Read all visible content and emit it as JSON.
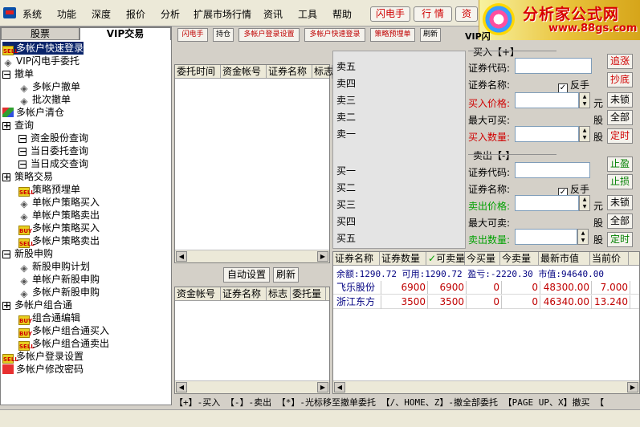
{
  "menu": [
    "系统",
    "功能",
    "深度",
    "报价",
    "分析",
    "扩展市场行情",
    "资讯",
    "工具",
    "帮助"
  ],
  "top_buttons": [
    "闪电手",
    "行 情",
    "资"
  ],
  "brand": {
    "title": "分析家公式网",
    "url": "www.88gs.com"
  },
  "left_tabs": [
    "股票",
    "VIP交易"
  ],
  "tree": [
    {
      "label": "多帐户快速登录",
      "icon": "sell",
      "indent": 0,
      "selected": true
    },
    {
      "label": "VIP闪电手委托",
      "icon": "diamond",
      "indent": 0
    },
    {
      "label": "撤单",
      "icon": "box",
      "indent": 0,
      "box": "−"
    },
    {
      "label": "多帐户撤单",
      "icon": "diamond",
      "indent": 1
    },
    {
      "label": "批次撤单",
      "icon": "diamond",
      "indent": 1
    },
    {
      "label": "多帐户清仓",
      "icon": "multi",
      "indent": 0
    },
    {
      "label": "查询",
      "icon": "box",
      "indent": 0,
      "box": "+"
    },
    {
      "label": "资金股份查询",
      "icon": "box",
      "indent": 1,
      "box": "−"
    },
    {
      "label": "当日委托查询",
      "icon": "box",
      "indent": 1,
      "box": "−"
    },
    {
      "label": "当日成交查询",
      "icon": "box",
      "indent": 1,
      "box": "−"
    },
    {
      "label": "策略交易",
      "icon": "box",
      "indent": 0,
      "box": "+"
    },
    {
      "label": "策略预埋单",
      "icon": "sell",
      "indent": 1
    },
    {
      "label": "单帐户策略买入",
      "icon": "diamond",
      "indent": 1
    },
    {
      "label": "单帐户策略卖出",
      "icon": "diamond",
      "indent": 1
    },
    {
      "label": "多帐户策略买入",
      "icon": "buy",
      "indent": 1
    },
    {
      "label": "多帐户策略卖出",
      "icon": "sell",
      "indent": 1
    },
    {
      "label": "新股申购",
      "icon": "box",
      "indent": 0,
      "box": "−"
    },
    {
      "label": "新股申购计划",
      "icon": "diamond",
      "indent": 1
    },
    {
      "label": "单帐户新股申购",
      "icon": "diamond",
      "indent": 1
    },
    {
      "label": "多帐户新股申购",
      "icon": "diamond",
      "indent": 1
    },
    {
      "label": "多帐户组合通",
      "icon": "box",
      "indent": 0,
      "box": "+"
    },
    {
      "label": "组合通编辑",
      "icon": "buy",
      "indent": 1
    },
    {
      "label": "多帐户组合通买入",
      "icon": "buy",
      "indent": 1
    },
    {
      "label": "多帐户组合通卖出",
      "icon": "sell",
      "indent": 1
    },
    {
      "label": "多帐户登录设置",
      "icon": "sell",
      "indent": 0
    },
    {
      "label": "多帐户修改密码",
      "icon": "red",
      "indent": 0
    }
  ],
  "icon_text": {
    "sell": "SELL",
    "buy": "BUY"
  },
  "toolbar": [
    "闪电手",
    "持仓",
    "多帐户登录设置",
    "多帐户快速登录",
    "策略预埋单",
    "刷新"
  ],
  "vip_label": "VIP闪",
  "order_grid": {
    "headers": [
      "委托时间",
      "资金帐号",
      "证券名称",
      "标志"
    ]
  },
  "order_buttons": [
    "自动设置",
    "刷新"
  ],
  "account_grid": {
    "headers": [
      "资金帐号",
      "证券名称",
      "标志",
      "委托量"
    ]
  },
  "quote": {
    "sell": [
      "卖五",
      "卖四",
      "卖三",
      "卖二",
      "卖一"
    ],
    "buy": [
      "买一",
      "买二",
      "买三",
      "买四",
      "买五"
    ]
  },
  "buy_form": {
    "title": "买入【+】",
    "code_label": "证券代码:",
    "name_label": "证券名称:",
    "reverse_label": "反手",
    "price_label": "买入价格:",
    "price_unit": "元",
    "max_label": "最大可买:",
    "max_unit": "股",
    "qty_label": "买入数量:",
    "qty_unit": "股",
    "check": "✓",
    "buttons": [
      "追涨",
      "抄底",
      "未锁",
      "全部",
      "定时"
    ]
  },
  "sell_form": {
    "title": "卖出【-】",
    "code_label": "证券代码:",
    "name_label": "证券名称:",
    "reverse_label": "反手",
    "price_label": "卖出价格:",
    "price_unit": "元",
    "max_label": "最大可卖:",
    "max_unit": "股",
    "qty_label": "卖出数量:",
    "qty_unit": "股",
    "check": "✓",
    "buttons": [
      "止盈",
      "止损",
      "未锁",
      "全部",
      "定时"
    ]
  },
  "positions": {
    "headers": [
      "证券名称",
      "证券数量",
      "可卖量",
      "今买量",
      "今卖量",
      "最新市值",
      "当前价"
    ],
    "checked_header_mark": "✓",
    "summary": "余额:1290.72 可用:1290.72 盈亏:-2220.30 市值:94640.00",
    "rows": [
      {
        "name": "飞乐股份",
        "qty": "6900",
        "sellable": "6900",
        "buy": "0",
        "sell": "0",
        "value": "48300.00",
        "price": "7.000"
      },
      {
        "name": "浙江东方",
        "qty": "3500",
        "sellable": "3500",
        "buy": "0",
        "sell": "0",
        "value": "46340.00",
        "price": "13.240"
      }
    ]
  },
  "status_text": "【+】-买入 【-】-卖出 【*】-光标移至撤单委托 【/、HOME、Z】-撤全部委托 【PAGE UP、X】撤买 【"
}
